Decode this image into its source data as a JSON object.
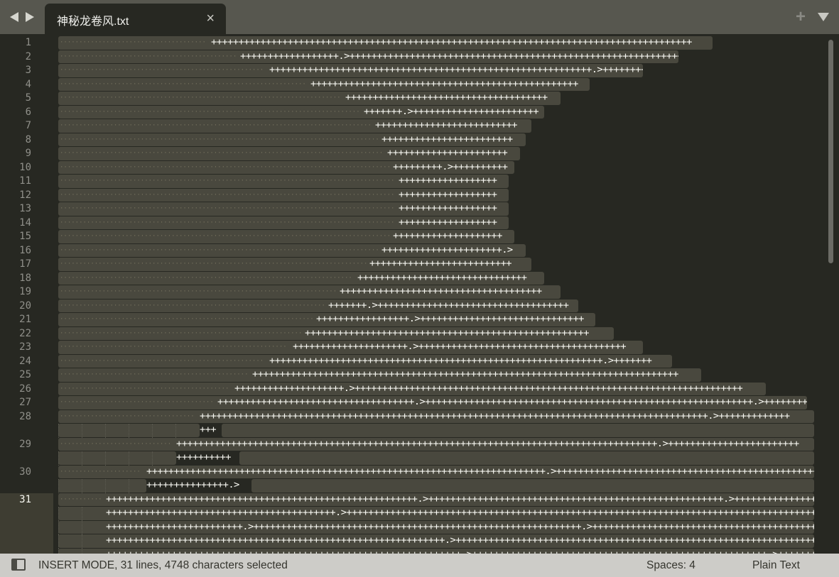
{
  "tabbar": {
    "tab_title": "神秘龙卷风.txt",
    "close_glyph": "×",
    "new_tab_glyph": "+"
  },
  "editor": {
    "line_numbers": [
      "1",
      "2",
      "3",
      "4",
      "5",
      "6",
      "7",
      "8",
      "9",
      "10",
      "11",
      "12",
      "13",
      "14",
      "15",
      "16",
      "17",
      "18",
      "19",
      "20",
      "21",
      "22",
      "23",
      "24",
      "25",
      "26",
      "27",
      "28",
      "29",
      "30",
      "31"
    ],
    "current_line": "31",
    "lines": [
      {
        "n": 1,
        "rows": [
          "++++++++++++++++++++++++++++++++++++++++++++++++++++++++++++++++++++++++++++++++++++++++"
        ]
      },
      {
        "n": 2,
        "rows": [
          "++++++++++++++++++.>+++++++++++++++++++++++++++++++++++++++++++++++++++++++++++++++++++"
        ]
      },
      {
        "n": 3,
        "rows": [
          "+++++++++++++++++++++++++++++++++++++++++++++++++++++++++++.>++++++++++"
        ]
      },
      {
        "n": 4,
        "rows": [
          "+++++++++++++++++++++++++++++++++++++++++++++++++"
        ]
      },
      {
        "n": 5,
        "rows": [
          "+++++++++++++++++++++++++++++++++++++"
        ]
      },
      {
        "n": 6,
        "rows": [
          "+++++++.>+++++++++++++++++++++++"
        ]
      },
      {
        "n": 7,
        "rows": [
          "++++++++++++++++++++++++++"
        ]
      },
      {
        "n": 8,
        "rows": [
          "++++++++++++++++++++++++"
        ]
      },
      {
        "n": 9,
        "rows": [
          "++++++++++++++++++++++"
        ]
      },
      {
        "n": 10,
        "rows": [
          "+++++++++.>++++++++++"
        ]
      },
      {
        "n": 11,
        "rows": [
          "++++++++++++++++++"
        ]
      },
      {
        "n": 12,
        "rows": [
          "++++++++++++++++++"
        ]
      },
      {
        "n": 13,
        "rows": [
          "++++++++++++++++++"
        ]
      },
      {
        "n": 14,
        "rows": [
          "++++++++++++++++++"
        ]
      },
      {
        "n": 15,
        "rows": [
          "++++++++++++++++++++"
        ]
      },
      {
        "n": 16,
        "rows": [
          "++++++++++++++++++++++.>"
        ]
      },
      {
        "n": 17,
        "rows": [
          "++++++++++++++++++++++++++"
        ]
      },
      {
        "n": 18,
        "rows": [
          "+++++++++++++++++++++++++++++++"
        ]
      },
      {
        "n": 19,
        "rows": [
          "+++++++++++++++++++++++++++++++++++++"
        ]
      },
      {
        "n": 20,
        "rows": [
          "+++++++.>+++++++++++++++++++++++++++++++++++"
        ]
      },
      {
        "n": 21,
        "rows": [
          "+++++++++++++++++.>++++++++++++++++++++++++++++++"
        ]
      },
      {
        "n": 22,
        "rows": [
          "++++++++++++++++++++++++++++++++++++++++++++++++++++"
        ]
      },
      {
        "n": 23,
        "rows": [
          "+++++++++++++++++++++.>++++++++++++++++++++++++++++++++++++++"
        ]
      },
      {
        "n": 24,
        "rows": [
          "+++++++++++++++++++++++++++++++++++++++++++++++++++++++++++++.>+++++++"
        ]
      },
      {
        "n": 25,
        "rows": [
          "++++++++++++++++++++++++++++++++++++++++++++++++++++++++++++++++++++++++++++++"
        ]
      },
      {
        "n": 26,
        "rows": [
          "++++++++++++++++++++.>+++++++++++++++++++++++++++++++++++++++++++++++++++++++++++++++++++++++"
        ]
      },
      {
        "n": 27,
        "rows": [
          "++++++++++++++++++++++++++++++++++++.>++++++++++++++++++++++++++++++++++++++++++++++++++++++++++++.>++++++++"
        ]
      },
      {
        "n": 28,
        "rows": [
          "+++++++++++++++++++++++++++++++++++++++++++++++++++++++++++++++++++++++++++++++++++++++++++++.>+++++++++++++",
          "+++"
        ]
      },
      {
        "n": 29,
        "rows": [
          "++++++++++++++++++++++++++++++++++++++++++++++++++++++++++++++++++++++++++++++++++++++++.>++++++++++++++++++++++++",
          "++++++++++"
        ]
      },
      {
        "n": 30,
        "rows": [
          "+++++++++++++++++++++++++++++++++++++++++++++++++++++++++++++++++++++++++.>++++++++++++++++++++++++++++++++++++++++++++++++++++++",
          "+++++++++++++++.>"
        ]
      },
      {
        "n": 31,
        "rows": [
          "+++++++++++++++++++++++++++++++++++++++++++++++++++++++++.>++++++++++++++++++++++++++++++++++++++++++++++++++++++.>++++++++++++++++",
          "++++++++++++++++++++++++++++++++++++++++++.>++++++++++++++++++++++++++++++++++++++++++++++++++++++++++++++++++++++++++++++++++++++",
          "+++++++++++++++++++++++++.>++++++++++++++++++++++++++++++++++++++++++++++++++++++++++++.>+++++++++++++++++++++++++++++++++++++++++++++",
          "++++++++++++++++++++++++++++++++++++++++++++++++++++++++++++++.>++++++++++++++++++++++++++++++++++++++++++++++++++++++++++++++++++++++",
          "+++++++++++++++++++++++++++++++++++++++++++++++++++++++++++++++++.>++++++++++++++++++++++++++++++++++++++++++++++++++++++.>+++++++++++"
        ]
      }
    ]
  },
  "statusbar": {
    "mode_text": "INSERT MODE, 31 lines, 4748 characters selected",
    "indentation": "Spaces: 4",
    "syntax": "Plain Text"
  },
  "colors": {
    "editor_bg": "#272822",
    "selection": "#49483e",
    "text": "#f8f8f2",
    "tabbar_bg": "#57574f",
    "statusbar_bg": "#cdccc8"
  }
}
